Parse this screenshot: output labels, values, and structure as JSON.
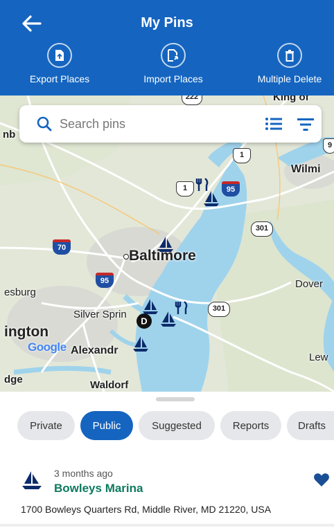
{
  "header": {
    "title": "My Pins",
    "actions": [
      {
        "label": "Export Places",
        "icon": "export-file-icon"
      },
      {
        "label": "Import Places",
        "icon": "import-file-icon"
      },
      {
        "label": "Multiple Delete",
        "icon": "trash-icon"
      }
    ]
  },
  "search": {
    "placeholder": "Search pins"
  },
  "map": {
    "places": {
      "baltimore": "Baltimore",
      "wilmington": "Wilmi",
      "dover": "Dover",
      "silver_spring": "Silver Sprin",
      "alexandria": "Alexandr",
      "waldorf": "Waldorf",
      "burg": "esburg",
      "ington": "ington",
      "lew": "Lew",
      "dge": "dge",
      "nb": "nb",
      "king": "King of"
    },
    "shields": {
      "i95a": "95",
      "i95b": "95",
      "i70": "70",
      "us1a": "1",
      "us1b": "1",
      "md301a": "301",
      "md301b": "301",
      "us9": "9",
      "us222": "222"
    },
    "attribution": "Google"
  },
  "tabs": [
    {
      "label": "Private",
      "active": false
    },
    {
      "label": "Public",
      "active": true
    },
    {
      "label": "Suggested",
      "active": false
    },
    {
      "label": "Reports",
      "active": false
    },
    {
      "label": "Drafts",
      "active": false
    }
  ],
  "pins": [
    {
      "time": "3 months ago",
      "name": "Bowleys Marina",
      "address": "1700 Bowleys Quarters Rd, Middle River, MD 21220, USA",
      "favorite": true,
      "icon": "sailboat-icon"
    }
  ],
  "colors": {
    "primary": "#1565c0",
    "pin_name": "#0d7a5f",
    "water": "#9fd3ec",
    "land": "#e3e7d8"
  }
}
